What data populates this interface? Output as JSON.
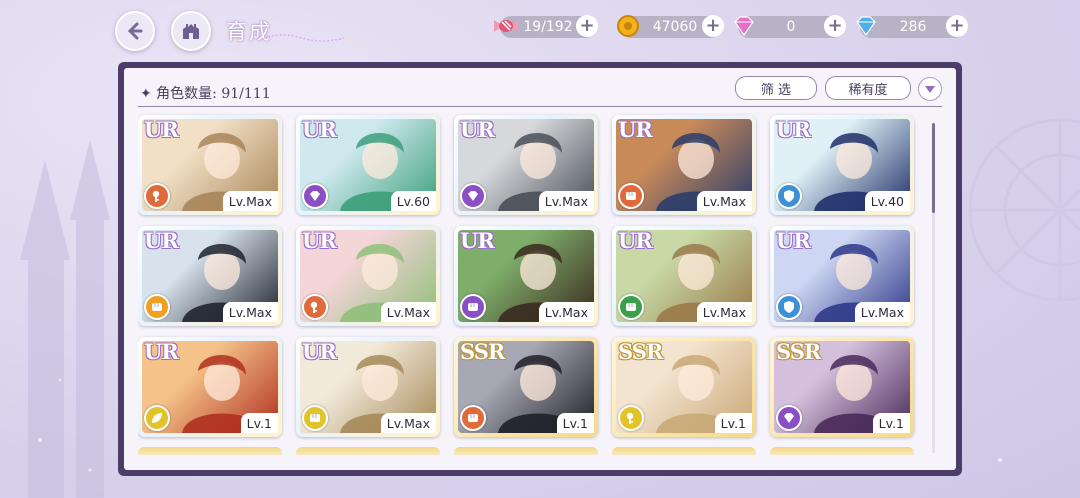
{
  "header": {
    "title": "育成",
    "back_icon": "back-arrow-icon",
    "home_icon": "castle-home-icon"
  },
  "resources": [
    {
      "name": "candy",
      "icon": "candy-icon",
      "value": "19/192",
      "color": "#e0577c"
    },
    {
      "name": "coin",
      "icon": "coin-icon",
      "value": "47060",
      "color": "#f2b11d"
    },
    {
      "name": "pink-gem",
      "icon": "pink-diamond-icon",
      "value": "0",
      "color": "#e46fc9"
    },
    {
      "name": "blue-gem",
      "icon": "blue-diamond-icon",
      "value": "286",
      "color": "#4fb0e8"
    }
  ],
  "panel": {
    "count_label": "✦ 角色数量: 91/111",
    "filter_label": "筛 选",
    "rarity_sort_label": "稀有度"
  },
  "cards": [
    {
      "rarity": "UR",
      "level": "Lv.Max",
      "type_color": "#e06a3a",
      "type_icon": "key-icon",
      "art": [
        "#f1e0c5",
        "#a9855a"
      ]
    },
    {
      "rarity": "UR",
      "level": "Lv.60",
      "type_color": "#8a4fc4",
      "type_icon": "gem-icon",
      "art": [
        "#cfe9ef",
        "#3d9f7a"
      ]
    },
    {
      "rarity": "UR",
      "level": "Lv.Max",
      "type_color": "#8a4fc4",
      "type_icon": "gem-icon",
      "art": [
        "#d6d8dc",
        "#4a5058"
      ]
    },
    {
      "rarity": "UR",
      "level": "Lv.Max",
      "type_color": "#e06a3a",
      "type_icon": "fist-icon",
      "art": [
        "#c98a5a",
        "#2b3d6a"
      ]
    },
    {
      "rarity": "UR",
      "level": "Lv.40",
      "type_color": "#3d8fd6",
      "type_icon": "shield-icon",
      "art": [
        "#dff1f6",
        "#20306a"
      ]
    },
    {
      "rarity": "UR",
      "level": "Lv.Max",
      "type_color": "#f0a020",
      "type_icon": "fist-icon",
      "art": [
        "#d7e2ec",
        "#202430"
      ]
    },
    {
      "rarity": "UR",
      "level": "Lv.Max",
      "type_color": "#e06a3a",
      "type_icon": "key-icon",
      "art": [
        "#f4d5d8",
        "#8fbf7a"
      ]
    },
    {
      "rarity": "UR",
      "level": "Lv.Max",
      "type_color": "#8a4fc4",
      "type_icon": "fist-icon",
      "art": [
        "#7fae6a",
        "#3a2a20"
      ]
    },
    {
      "rarity": "UR",
      "level": "Lv.Max",
      "type_color": "#3aa04a",
      "type_icon": "fist-icon",
      "art": [
        "#c8d9a6",
        "#9a7a4a"
      ]
    },
    {
      "rarity": "UR",
      "level": "Lv.Max",
      "type_color": "#3d8fd6",
      "type_icon": "shield-icon",
      "art": [
        "#cdd6f2",
        "#2f3a8a"
      ]
    },
    {
      "rarity": "UR",
      "level": "Lv.1",
      "type_color": "#e3c32a",
      "type_icon": "leaf-icon",
      "art": [
        "#f5c38a",
        "#b03020"
      ]
    },
    {
      "rarity": "UR",
      "level": "Lv.Max",
      "type_color": "#e3c32a",
      "type_icon": "fist-icon",
      "art": [
        "#f2ead9",
        "#a68a5a"
      ]
    },
    {
      "rarity": "SSR",
      "level": "Lv.1",
      "type_color": "#e06a3a",
      "type_icon": "fist-icon",
      "art": [
        "#a8a8b4",
        "#202028"
      ]
    },
    {
      "rarity": "SSR",
      "level": "Lv.1",
      "type_color": "#e3c32a",
      "type_icon": "key-icon",
      "art": [
        "#f3e4cf",
        "#c9a878"
      ]
    },
    {
      "rarity": "SSR",
      "level": "Lv.1",
      "type_color": "#8a4fc4",
      "type_icon": "gem-icon",
      "art": [
        "#d4c0dc",
        "#4a2a5a"
      ]
    }
  ]
}
